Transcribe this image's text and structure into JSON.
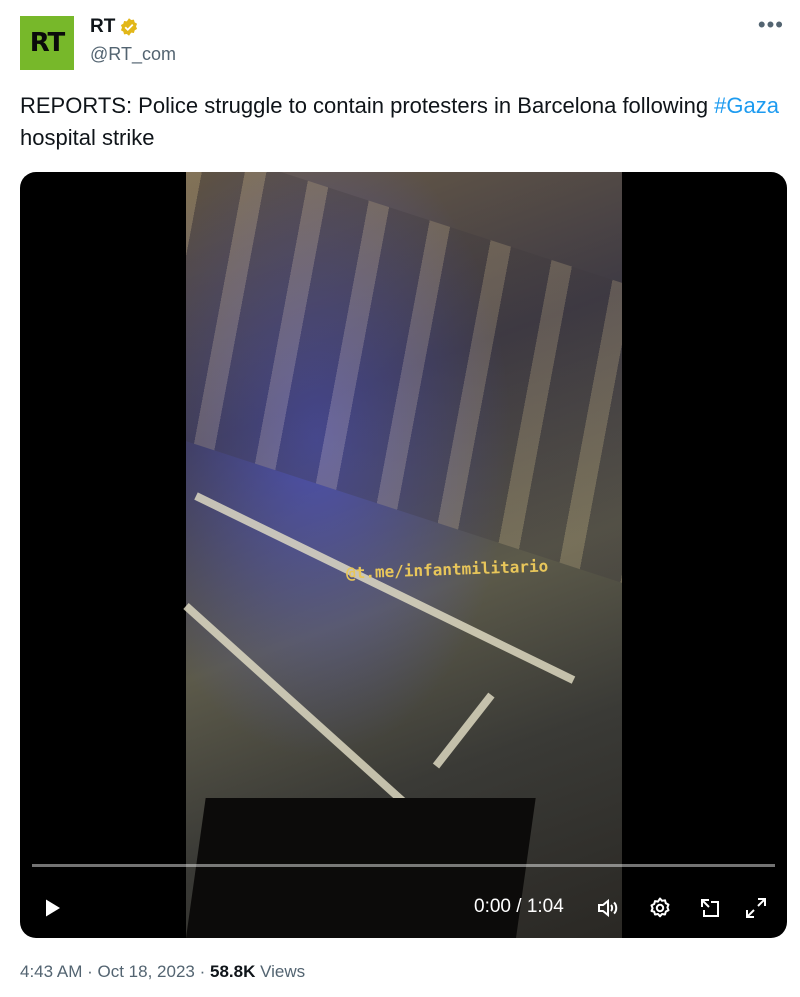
{
  "author": {
    "avatar_text": "RT",
    "display_name": "RT",
    "handle": "@RT_com",
    "verified_color": "#e2b719",
    "avatar_color": "#77b82a"
  },
  "tweet": {
    "text_before": "REPORTS: Police struggle to contain protesters in Barcelona following ",
    "hashtag": "#Gaza",
    "text_after": " hospital strike"
  },
  "video": {
    "watermark": "@t.me/infantmilitario",
    "time_display": "0:00 / 1:04",
    "progress": 0.0
  },
  "footer": {
    "time": "4:43 AM",
    "separator": "·",
    "date": "Oct 18, 2023",
    "views_count": "58.8K",
    "views_label": "Views"
  },
  "icons": {
    "more": "more-icon",
    "verified": "verified-badge-icon",
    "play": "play-icon",
    "volume": "volume-icon",
    "settings": "settings-icon",
    "minimize": "picture-in-picture-icon",
    "fullscreen": "fullscreen-icon"
  },
  "colors": {
    "accent": "#1d9bf0",
    "text": "#0f1419",
    "muted": "#536471"
  }
}
